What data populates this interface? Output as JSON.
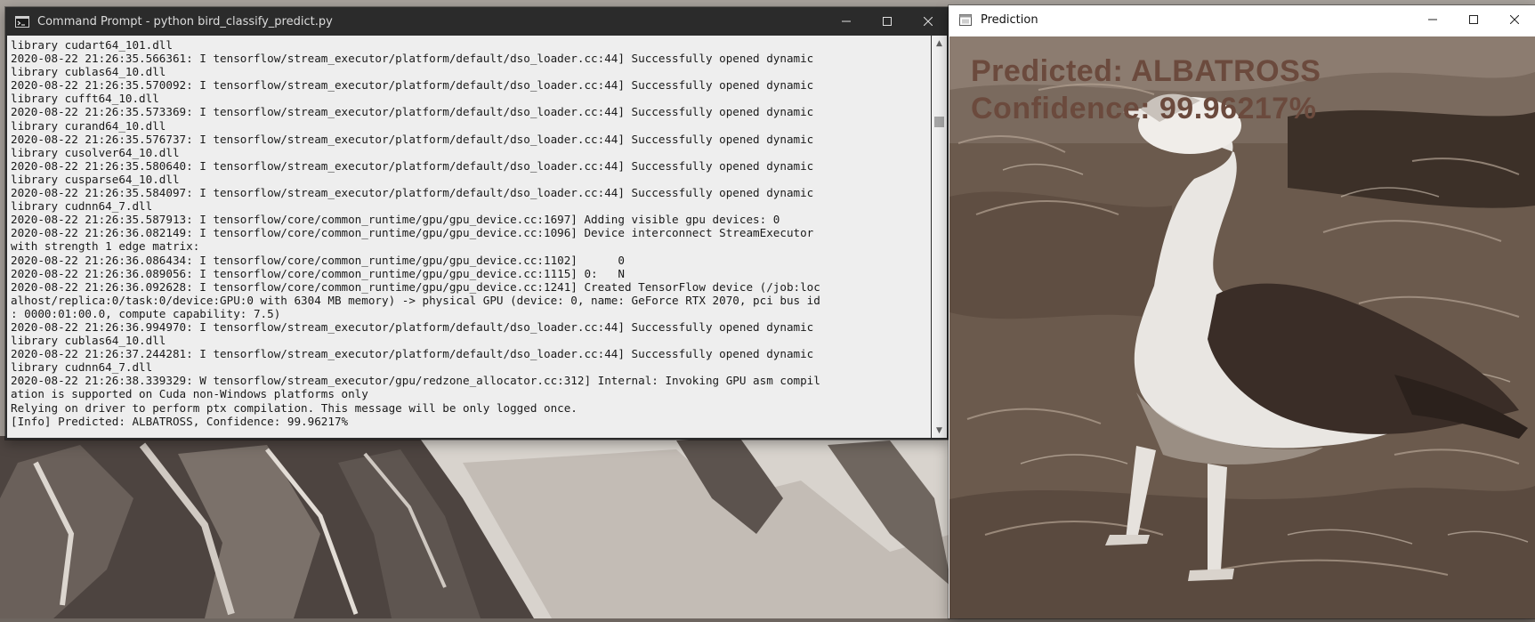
{
  "cmd_window": {
    "title": "Command Prompt - python  bird_classify_predict.py",
    "lines": [
      "library cudart64_101.dll",
      "2020-08-22 21:26:35.566361: I tensorflow/stream_executor/platform/default/dso_loader.cc:44] Successfully opened dynamic",
      "library cublas64_10.dll",
      "2020-08-22 21:26:35.570092: I tensorflow/stream_executor/platform/default/dso_loader.cc:44] Successfully opened dynamic",
      "library cufft64_10.dll",
      "2020-08-22 21:26:35.573369: I tensorflow/stream_executor/platform/default/dso_loader.cc:44] Successfully opened dynamic",
      "library curand64_10.dll",
      "2020-08-22 21:26:35.576737: I tensorflow/stream_executor/platform/default/dso_loader.cc:44] Successfully opened dynamic",
      "library cusolver64_10.dll",
      "2020-08-22 21:26:35.580640: I tensorflow/stream_executor/platform/default/dso_loader.cc:44] Successfully opened dynamic",
      "library cusparse64_10.dll",
      "2020-08-22 21:26:35.584097: I tensorflow/stream_executor/platform/default/dso_loader.cc:44] Successfully opened dynamic",
      "library cudnn64_7.dll",
      "2020-08-22 21:26:35.587913: I tensorflow/core/common_runtime/gpu/gpu_device.cc:1697] Adding visible gpu devices: 0",
      "2020-08-22 21:26:36.082149: I tensorflow/core/common_runtime/gpu/gpu_device.cc:1096] Device interconnect StreamExecutor",
      "with strength 1 edge matrix:",
      "2020-08-22 21:26:36.086434: I tensorflow/core/common_runtime/gpu/gpu_device.cc:1102]      0",
      "2020-08-22 21:26:36.089056: I tensorflow/core/common_runtime/gpu/gpu_device.cc:1115] 0:   N",
      "2020-08-22 21:26:36.092628: I tensorflow/core/common_runtime/gpu/gpu_device.cc:1241] Created TensorFlow device (/job:loc",
      "alhost/replica:0/task:0/device:GPU:0 with 6304 MB memory) -> physical GPU (device: 0, name: GeForce RTX 2070, pci bus id",
      ": 0000:01:00.0, compute capability: 7.5)",
      "2020-08-22 21:26:36.994970: I tensorflow/stream_executor/platform/default/dso_loader.cc:44] Successfully opened dynamic",
      "library cublas64_10.dll",
      "2020-08-22 21:26:37.244281: I tensorflow/stream_executor/platform/default/dso_loader.cc:44] Successfully opened dynamic",
      "library cudnn64_7.dll",
      "2020-08-22 21:26:38.339329: W tensorflow/stream_executor/gpu/redzone_allocator.cc:312] Internal: Invoking GPU asm compil",
      "ation is supported on Cuda non-Windows platforms only",
      "Relying on driver to perform ptx compilation. This message will be only logged once.",
      "[Info] Predicted: ALBATROSS, Confidence: 99.96217%"
    ]
  },
  "pred_window": {
    "title": "Prediction",
    "overlay_line1": "Predicted: ALBATROSS",
    "overlay_line2": "Confidence: 99.96217%"
  },
  "colors": {
    "console_bg": "#eeeeee",
    "console_fg": "#1a1a1a",
    "cmd_titlebar": "#2b2b2b",
    "overlay_text": "#6b4a3d"
  },
  "icons": {
    "cmd_app": "cmd-app-icon",
    "pred_app": "window-app-icon",
    "minimize": "minimize-icon",
    "maximize": "maximize-icon",
    "close": "close-icon"
  }
}
